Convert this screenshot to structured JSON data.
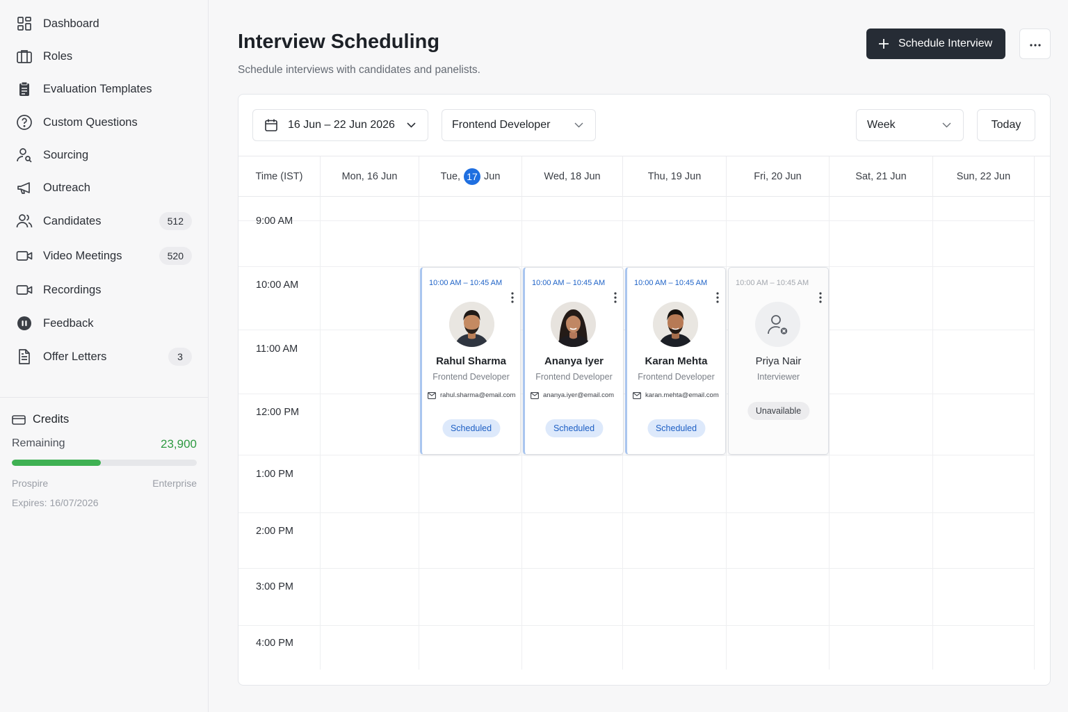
{
  "sidebar": {
    "items": [
      {
        "label": "Dashboard",
        "icon": "grid-icon"
      },
      {
        "label": "Roles",
        "icon": "briefcase-icon"
      },
      {
        "label": "Evaluation Templates",
        "icon": "clipboard-icon"
      },
      {
        "label": "Custom Questions",
        "icon": "question-circle-icon"
      },
      {
        "label": "Sourcing",
        "icon": "user-search-icon"
      },
      {
        "label": "Outreach",
        "icon": "megaphone-icon"
      },
      {
        "label": "Candidates",
        "icon": "users-icon",
        "count": "512"
      },
      {
        "label": "Video Meetings",
        "icon": "video-icon",
        "count": "520"
      },
      {
        "label": "Recordings",
        "icon": "video-icon"
      },
      {
        "label": "Feedback",
        "icon": "pause-circle-icon"
      },
      {
        "label": "Offer Letters",
        "icon": "document-icon",
        "count": "3"
      }
    ],
    "credits": {
      "title": "Credits",
      "remaining_label": "Remaining",
      "remaining_value": "23,900",
      "progress_fraction": 0.48,
      "plan_current": "Prospire",
      "plan_next": "Enterprise",
      "expires": "Expires: 16/07/2026"
    }
  },
  "header": {
    "title": "Interview Scheduling",
    "subtitle": "Schedule interviews with candidates and panelists.",
    "primary_button": "Schedule Interview"
  },
  "controls": {
    "date_range": "16 Jun – 22 Jun 2026",
    "role_filter": "Frontend Developer",
    "view": "Week",
    "today_button": "Today"
  },
  "calendar": {
    "time_header": "Time (IST)",
    "days": [
      {
        "prefix": "Mon, 16 Jun"
      },
      {
        "prefix": "Tue,",
        "badge": "17",
        "suffix": "Jun"
      },
      {
        "prefix": "Wed, 18 Jun"
      },
      {
        "prefix": "Thu, 19 Jun"
      },
      {
        "prefix": "Fri, 20 Jun"
      },
      {
        "prefix": "Sat, 21 Jun"
      },
      {
        "prefix": "Sun, 22 Jun"
      }
    ],
    "times": [
      "9:00 AM",
      "10:00 AM",
      "11:00 AM",
      "12:00 PM",
      "1:00 PM",
      "2:00 PM",
      "3:00 PM",
      "4:00 PM"
    ],
    "events": [
      {
        "time": "10:00 AM – 10:45 AM",
        "name": "Rahul Sharma",
        "role": "Frontend Developer",
        "email": "rahul.sharma@email.com",
        "status": "Scheduled",
        "avatar": "male"
      },
      {
        "time": "10:00 AM – 10:45 AM",
        "name": "Ananya Iyer",
        "role": "Frontend Developer",
        "email": "ananya.iyer@email.com",
        "status": "Scheduled",
        "avatar": "female"
      },
      {
        "time": "10:00 AM – 10:45 AM",
        "name": "Karan Mehta",
        "role": "Frontend Developer",
        "email": "karan.mehta@email.com",
        "status": "Scheduled",
        "avatar": "male"
      },
      {
        "time": "10:00 AM – 10:45 AM",
        "name": "Priya Nair",
        "role": "Interviewer",
        "status": "Unavailable",
        "avatar": "placeholder"
      }
    ]
  },
  "colors": {
    "accent": "#1f6fe0",
    "primary_button": "#262c35",
    "credits_green": "#3fb153"
  }
}
